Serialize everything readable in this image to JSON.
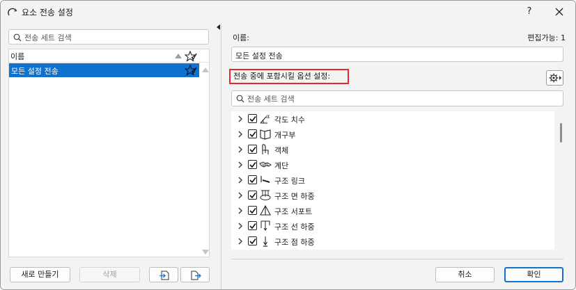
{
  "window": {
    "title": "요소 전송 설정",
    "help_label": "?"
  },
  "left": {
    "search_placeholder": "전송 세트 검색",
    "list_header": "이름",
    "items": [
      {
        "label": "모든 설정 전송",
        "selected": true
      }
    ],
    "buttons": {
      "new_label": "새로 만들기",
      "delete_label": "삭제"
    }
  },
  "right": {
    "name_label": "이름:",
    "editable_label": "편집가능: 1",
    "name_value": "모든 설정 전송",
    "options_label": "전송 중에 포함시킬 옵션 설정:",
    "search_placeholder": "전송 세트 검색",
    "tree_items": [
      {
        "label": "각도 치수",
        "icon": "angle-dimension-icon",
        "checked": true
      },
      {
        "label": "개구부",
        "icon": "opening-icon",
        "checked": true
      },
      {
        "label": "객체",
        "icon": "object-icon",
        "checked": true
      },
      {
        "label": "계단",
        "icon": "stair-icon",
        "checked": true
      },
      {
        "label": "구조 링크",
        "icon": "structural-link-icon",
        "checked": true
      },
      {
        "label": "구조 면 하중",
        "icon": "surface-load-icon",
        "checked": true
      },
      {
        "label": "구조 서포트",
        "icon": "structural-support-icon",
        "checked": true
      },
      {
        "label": "구조 선 하중",
        "icon": "line-load-icon",
        "checked": true
      },
      {
        "label": "구조 점 하중",
        "icon": "point-load-icon",
        "checked": true
      }
    ],
    "buttons": {
      "cancel_label": "취소",
      "ok_label": "확인"
    }
  },
  "colors": {
    "selection": "#0f72d1",
    "highlight_border": "#e8262b",
    "background": "#f3f3f3"
  }
}
